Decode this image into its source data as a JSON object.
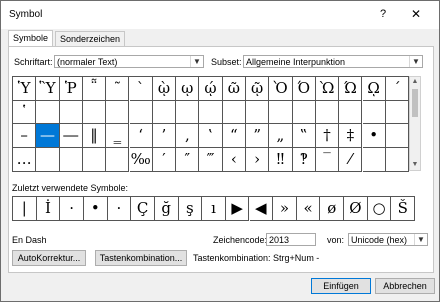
{
  "window": {
    "title": "Symbol",
    "help": "?",
    "close": "✕"
  },
  "tabs": [
    {
      "label": "Symbole"
    },
    {
      "label": "Sonderzeichen"
    }
  ],
  "font": {
    "label": "Schriftart:",
    "value": "(normaler Text)"
  },
  "subset": {
    "label": "Subset:",
    "value": "Allgemeine Interpunktion"
  },
  "grid_rows": [
    [
      "Ὑ",
      "Ὓ",
      "Ῥ",
      "῁",
      "῀",
      "`",
      "ῲ",
      "ῳ",
      "ῴ",
      "ῶ",
      "ῷ",
      "Ὸ",
      "Ό",
      "Ὼ",
      "Ώ",
      "ῼ",
      "´"
    ],
    [
      "῾",
      "",
      "",
      "",
      "",
      "",
      "",
      "",
      "",
      "",
      "",
      "",
      "",
      "",
      "",
      "",
      ""
    ],
    [
      "–",
      "—",
      "―",
      "‖",
      "‗",
      "‘",
      "’",
      "‚",
      "‛",
      "“",
      "”",
      "„",
      "‟",
      "†",
      "‡",
      "•",
      ""
    ],
    [
      "…",
      "",
      "",
      "",
      "",
      "‰",
      "′",
      "″",
      "‴",
      "‹",
      "›",
      "‼",
      "‽",
      "‾",
      "⁄",
      "",
      ""
    ]
  ],
  "selected_symbol": "—",
  "recent": {
    "label": "Zuletzt verwendete Symbole:",
    "symbols": [
      "|",
      "İ",
      "·",
      "•",
      "·",
      "Ç",
      "ğ",
      "ş",
      "ı",
      "▶",
      "◀",
      "»",
      "«",
      "ø",
      "Ø",
      "○",
      "Š"
    ]
  },
  "symbol_name": "En Dash",
  "charcode": {
    "label": "Zeichencode:",
    "value": "2013"
  },
  "from": {
    "label": "von:",
    "value": "Unicode (hex)"
  },
  "buttons": {
    "autocorrect": "AutoKorrektur...",
    "shortcut": "Tastenkombination...",
    "insert": "Einfügen",
    "cancel": "Abbrechen"
  },
  "shortcut_text": "Tastenkombination: Strg+Num -"
}
